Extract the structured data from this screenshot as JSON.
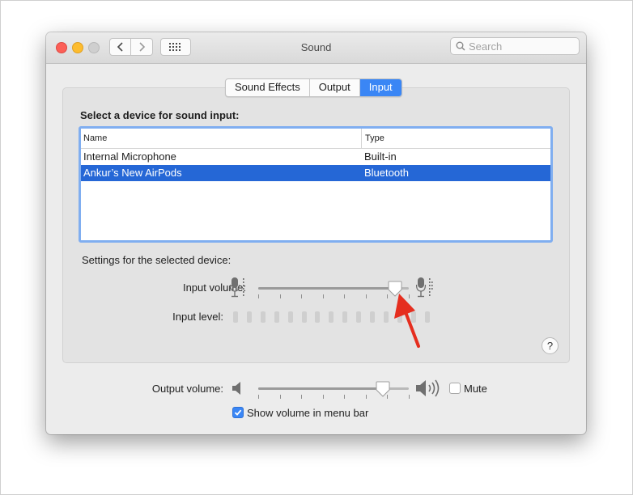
{
  "window": {
    "title": "Sound"
  },
  "search": {
    "placeholder": "Search"
  },
  "tabs": [
    {
      "label": "Sound Effects",
      "active": false
    },
    {
      "label": "Output",
      "active": false
    },
    {
      "label": "Input",
      "active": true
    }
  ],
  "input_panel": {
    "section_label": "Select a device for sound input:",
    "columns": [
      "Name",
      "Type"
    ],
    "devices": [
      {
        "name": "Internal Microphone",
        "type": "Built-in",
        "selected": false
      },
      {
        "name": "Ankur’s New AirPods",
        "type": "Bluetooth",
        "selected": true
      }
    ],
    "settings_label": "Settings for the selected device:",
    "input_volume_label": "Input volume:",
    "input_volume_level": 0.91,
    "input_level_label": "Input level:",
    "input_level_segments": 15,
    "input_level_active": 0,
    "help_label": "?"
  },
  "output": {
    "volume_label": "Output volume:",
    "volume_level": 0.83,
    "mute_label": "Mute",
    "mute_checked": false,
    "show_volume_label": "Show volume in menu bar",
    "show_volume_checked": true
  },
  "icons": {
    "close": "close-icon",
    "minimize": "minimize-icon",
    "zoom": "zoom-icon",
    "back": "chevron-left-icon",
    "forward": "chevron-right-icon",
    "grid": "grid-icon",
    "search": "magnifier-icon",
    "mic_low": "microphone-low-icon",
    "mic_high": "microphone-high-icon",
    "speaker_low": "speaker-low-icon",
    "speaker_high": "speaker-high-icon",
    "annotation": "red-arrow-annotation"
  },
  "colors": {
    "accent": "#3a86f5",
    "selection": "#2567d6",
    "focus_ring": "#80aef0",
    "annotation_arrow": "#e52e1f"
  }
}
